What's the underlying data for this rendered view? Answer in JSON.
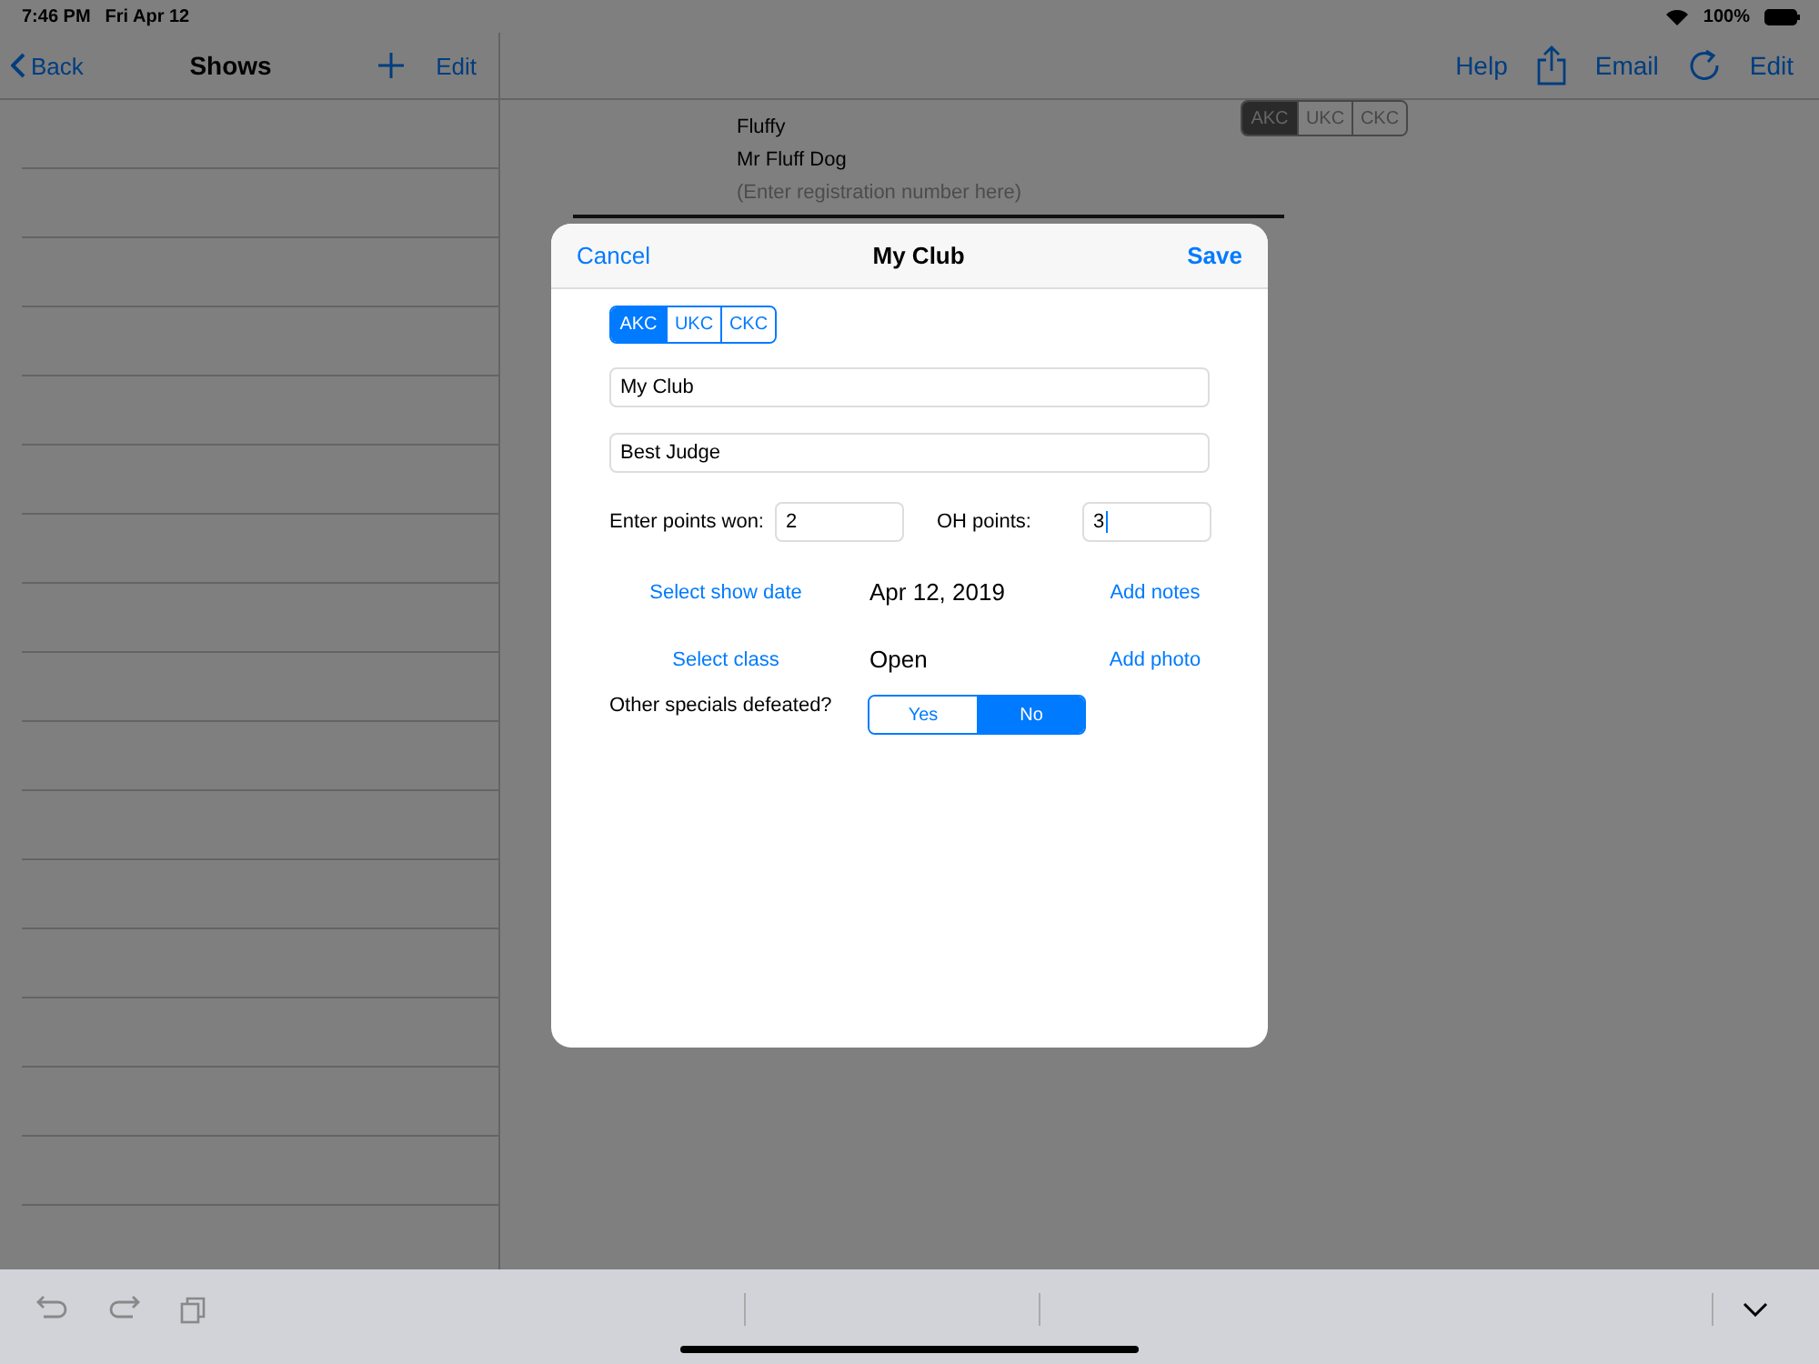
{
  "status_bar": {
    "time": "7:46 PM",
    "date": "Fri Apr 12",
    "battery": "100%"
  },
  "sidebar": {
    "back": "Back",
    "title": "Shows",
    "edit": "Edit"
  },
  "detail": {
    "toolbar": [
      {
        "kind": "text",
        "label": "Help"
      },
      {
        "kind": "share"
      },
      {
        "kind": "text",
        "label": "Email"
      },
      {
        "kind": "refresh"
      },
      {
        "kind": "text",
        "label": "Edit"
      }
    ],
    "lines": [
      "Fluffy",
      "Mr Fluff Dog"
    ],
    "registration_placeholder": "(Enter registration number here)",
    "registry": [
      {
        "label": "AKC",
        "selected": true
      },
      {
        "label": "UKC",
        "selected": false
      },
      {
        "label": "CKC",
        "selected": false
      }
    ]
  },
  "dialog": {
    "cancel": "Cancel",
    "title": "My Club",
    "save": "Save",
    "registry": [
      {
        "label": "AKC",
        "selected": true
      },
      {
        "label": "UKC",
        "selected": false
      },
      {
        "label": "CKC",
        "selected": false
      }
    ],
    "club": "My Club",
    "judge": "Best Judge",
    "points_label": "Enter points won:",
    "points": "2",
    "oh_label": "OH points:",
    "oh_points": "3",
    "date_link": "Select show date",
    "date": "Apr 12, 2019",
    "notes_link": "Add notes",
    "class_link": "Select class",
    "class": "Open",
    "photo_link": "Add photo",
    "specials_label": "Other specials defeated?",
    "specials": [
      {
        "label": "Yes",
        "selected": false
      },
      {
        "label": "No",
        "selected": true
      }
    ]
  }
}
